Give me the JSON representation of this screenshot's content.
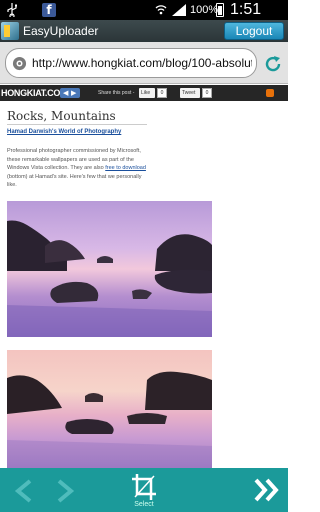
{
  "status_bar": {
    "battery": "100%",
    "time": "1:51 AM",
    "icons": [
      "usb-icon",
      "facebook-icon",
      "signal-icon",
      "battery-icon"
    ],
    "facebook_glyph": "f"
  },
  "app_bar": {
    "title": "EasyUploader",
    "logout_label": "Logout"
  },
  "address_bar": {
    "url": "http://www.hongkiat.com/blog/100-absolute",
    "icons": [
      "globe-icon",
      "refresh-icon"
    ]
  },
  "webpage": {
    "site_bar": {
      "logo": "HONGKIAT.COM",
      "share_label": "Share this post -",
      "buttons": [
        {
          "label": "Like",
          "count": "0"
        },
        {
          "label": "Tweet",
          "count": "0"
        }
      ]
    },
    "article": {
      "title": "Rocks, Mountains",
      "author_link": "Hamad Darwish's World of Photography",
      "paragraph_1": "Professional photographer commissioned by Microsoft, these remarkable wallpapers are used as part of the Windows Vista collection. They are also",
      "paragraph_link": "free to download",
      "paragraph_2": "(bottom) at Hamad's site. Here's few that we personally like."
    }
  },
  "bottom_bar": {
    "select_label": "Select",
    "icons": [
      "back-arrow-icon",
      "forward-arrow-icon",
      "crop-icon",
      "double-chevron-right-icon"
    ]
  },
  "colors": {
    "app_bar": "#2b3538",
    "logout_button": "#1a86b6",
    "bottom_bar": "#1b9a9a",
    "link": "#1a4f9c"
  }
}
